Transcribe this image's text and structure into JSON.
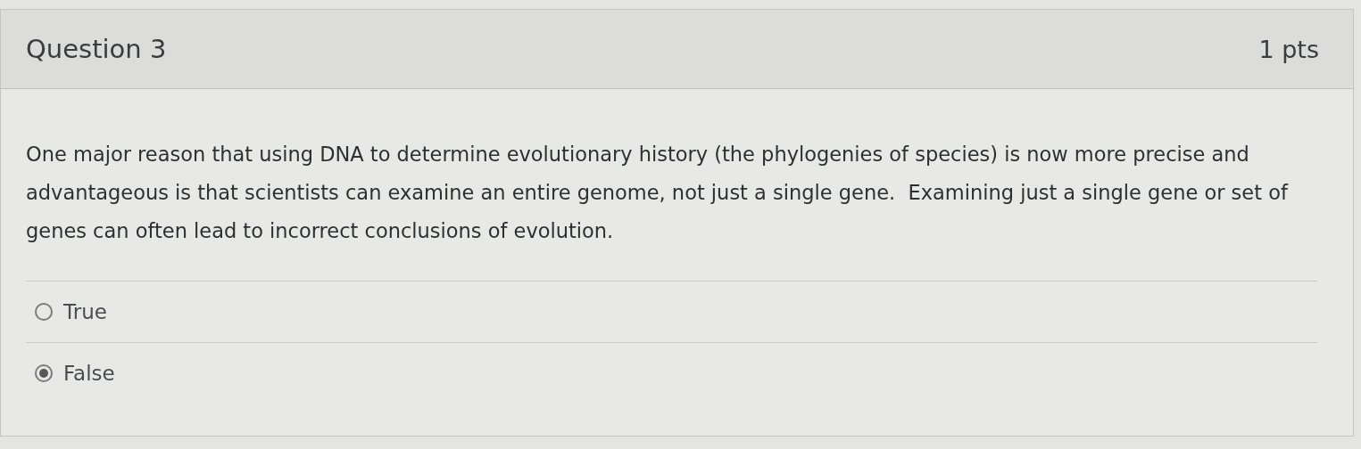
{
  "question": {
    "title": "Question 3",
    "points": "1 pts",
    "text": "One major reason that using DNA to determine evolutionary history (the phylogenies of species) is now more precise and advantageous is that scientists can examine an entire genome, not just a single gene.  Examining just a single gene or set of genes can often lead to incorrect conclusions of evolution.",
    "answers": [
      {
        "label": "True",
        "selected": false
      },
      {
        "label": "False",
        "selected": true
      }
    ]
  }
}
